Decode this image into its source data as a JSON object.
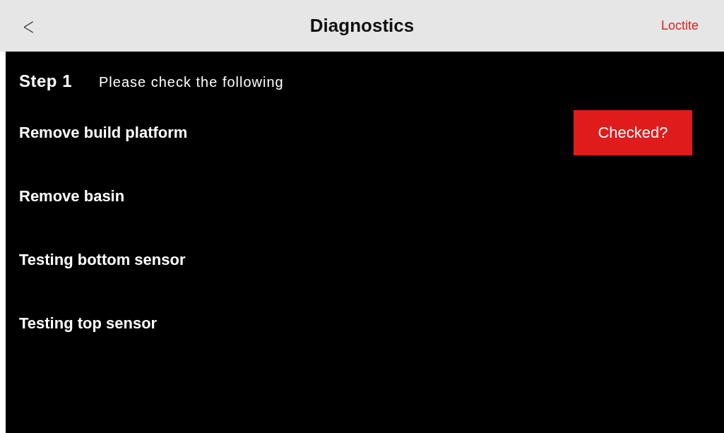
{
  "header": {
    "back": "<",
    "title": "Diagnostics",
    "brand": "Loctite"
  },
  "step": {
    "label": "Step 1",
    "instruction": "Please check the following"
  },
  "items": [
    {
      "label": "Remove build platform",
      "button": "Checked?"
    },
    {
      "label": "Remove basin"
    },
    {
      "label": "Testing bottom sensor"
    },
    {
      "label": "Testing top sensor"
    }
  ]
}
